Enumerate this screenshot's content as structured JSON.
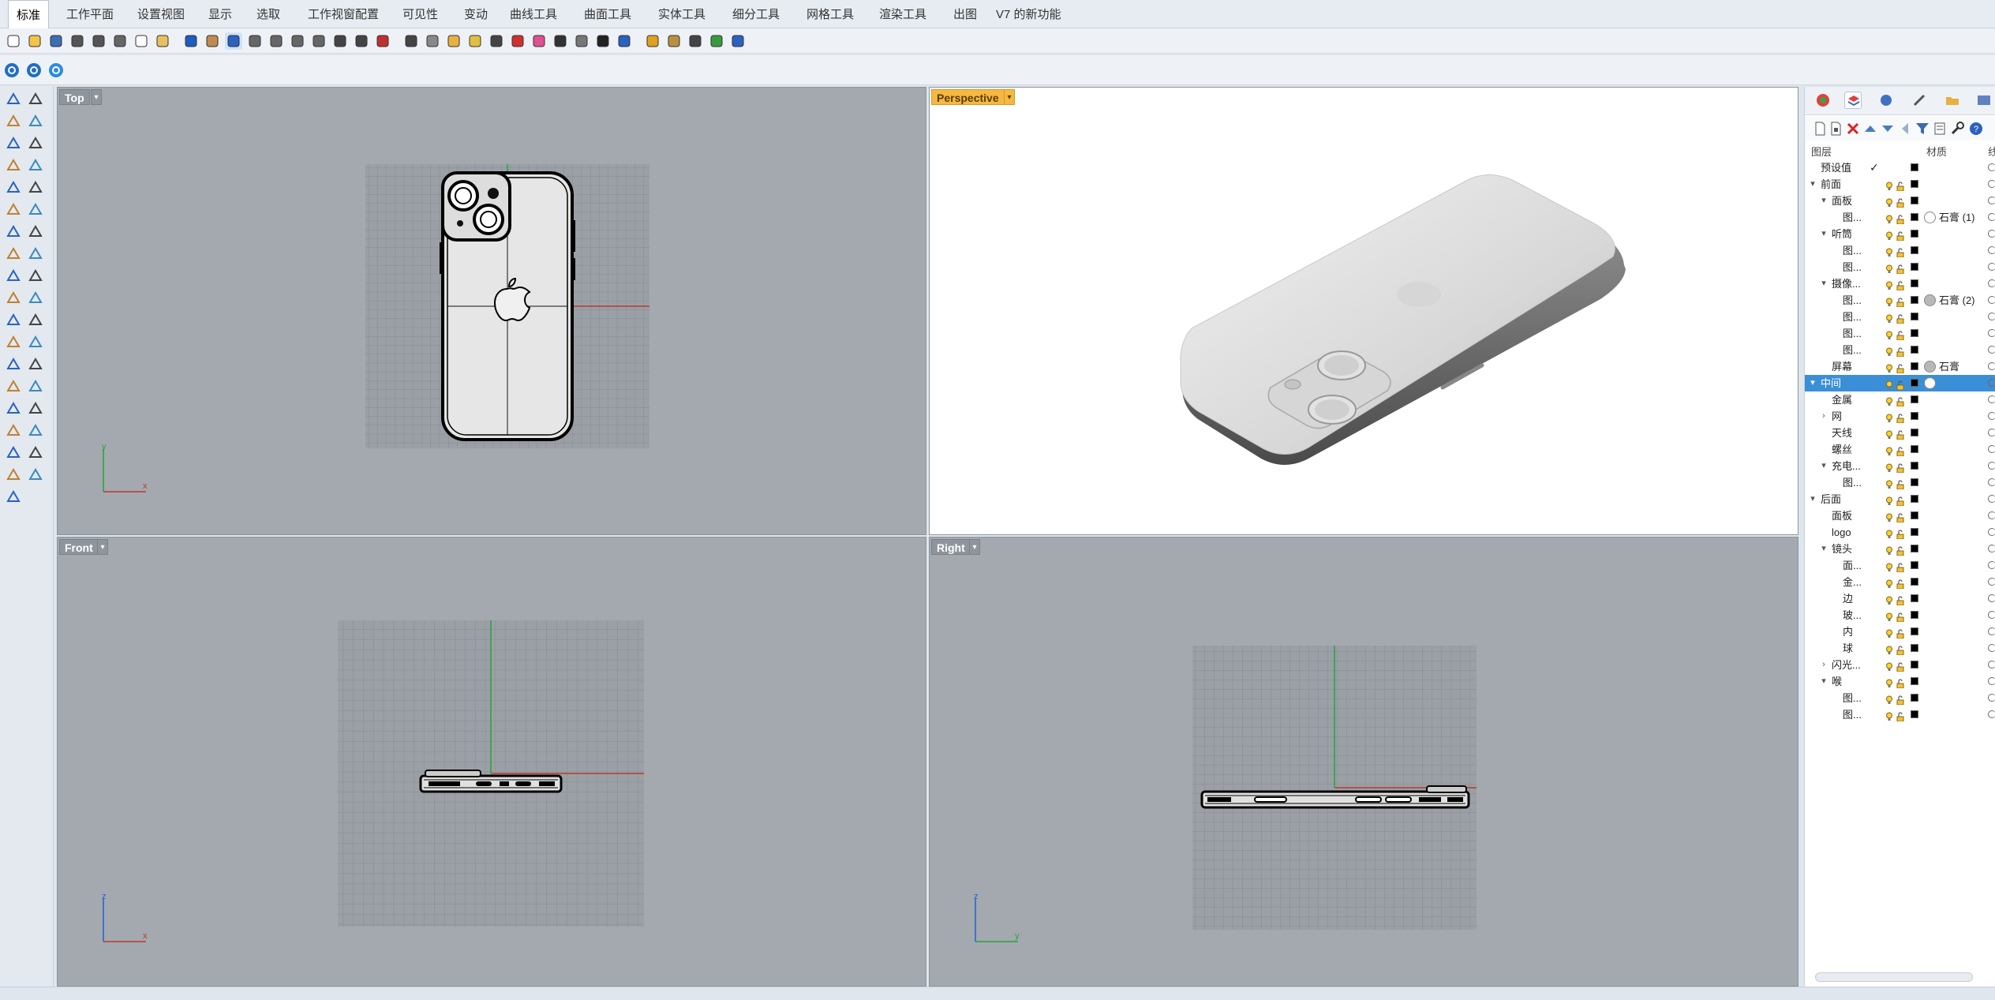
{
  "tabs": [
    {
      "label": "标准",
      "active": true
    },
    {
      "label": "工作平面"
    },
    {
      "label": "设置视图"
    },
    {
      "label": "显示"
    },
    {
      "label": "选取"
    },
    {
      "label": "工作视窗配置"
    },
    {
      "label": "可见性"
    },
    {
      "label": "变动"
    },
    {
      "label": "曲线工具"
    },
    {
      "label": "曲面工具"
    },
    {
      "label": "实体工具"
    },
    {
      "label": "细分工具"
    },
    {
      "label": "网格工具"
    },
    {
      "label": "渲染工具"
    },
    {
      "label": "出图"
    },
    {
      "label": "V7 的新功能"
    }
  ],
  "toolbar_icons": [
    "new-file-icon",
    "open-folder-icon",
    "save-icon",
    "print-icon",
    "import-icon",
    "cut-icon",
    "copy-icon",
    "paste-icon",
    "undo-icon",
    "pan-hand-icon",
    "select-point-icon",
    "zoom-icon",
    "zoom-window-icon",
    "zoom-extents-icon",
    "zoom-selected-icon",
    "rotate-view-icon",
    "viewport-layout-icon",
    "car-icon",
    "grid-snap-icon",
    "osnap-icon",
    "layer-icon",
    "light-icon",
    "lock-icon",
    "material-icon",
    "color-wheel-icon",
    "sphere-render-icon",
    "sphere-shaded-icon",
    "sphere-dark-icon",
    "globe-icon",
    "pen-icon",
    "gear-group-icon",
    "block-icon",
    "planet-icon",
    "help-icon"
  ],
  "viewports": {
    "top": {
      "title": "Top"
    },
    "perspective": {
      "title": "Perspective",
      "active": true
    },
    "front": {
      "title": "Front"
    },
    "right": {
      "title": "Right"
    }
  },
  "axes": {
    "top": {
      "x": "x",
      "y": "y"
    },
    "front": {
      "x": "x",
      "y": "z"
    },
    "right": {
      "x": "y",
      "y": "z"
    }
  },
  "layers_panel": {
    "header_layers": "图层",
    "header_material": "材质",
    "header_extra": "线",
    "rows": [
      {
        "name": "预设值",
        "indent": 0,
        "expander": "",
        "check": true,
        "selected": false,
        "material": ""
      },
      {
        "name": "前面",
        "indent": 0,
        "expander": "v",
        "selected": false,
        "material": ""
      },
      {
        "name": "面板",
        "indent": 1,
        "expander": "v",
        "selected": false,
        "material": ""
      },
      {
        "name": "图...",
        "indent": 2,
        "expander": "",
        "selected": false,
        "material": "石膏 (1)",
        "mat_circle": "white"
      },
      {
        "name": "听筒",
        "indent": 1,
        "expander": "v",
        "selected": false,
        "material": ""
      },
      {
        "name": "图...",
        "indent": 2,
        "expander": "",
        "selected": false,
        "material": ""
      },
      {
        "name": "图...",
        "indent": 2,
        "expander": "",
        "selected": false,
        "material": ""
      },
      {
        "name": "摄像...",
        "indent": 1,
        "expander": "v",
        "selected": false,
        "material": ""
      },
      {
        "name": "图...",
        "indent": 2,
        "expander": "",
        "selected": false,
        "material": "石膏 (2)",
        "mat_circle": "gray"
      },
      {
        "name": "图...",
        "indent": 2,
        "expander": "",
        "selected": false,
        "material": ""
      },
      {
        "name": "图...",
        "indent": 2,
        "expander": "",
        "selected": false,
        "material": ""
      },
      {
        "name": "图...",
        "indent": 2,
        "expander": "",
        "selected": false,
        "material": ""
      },
      {
        "name": "屏幕",
        "indent": 1,
        "expander": "",
        "selected": false,
        "material": "石膏",
        "mat_circle": "gray"
      },
      {
        "name": "中间",
        "indent": 0,
        "expander": "v",
        "selected": true,
        "material": "",
        "mat_circle": "white"
      },
      {
        "name": "金属",
        "indent": 1,
        "expander": "",
        "selected": false,
        "material": ""
      },
      {
        "name": "网",
        "indent": 1,
        "expander": ">",
        "selected": false,
        "material": ""
      },
      {
        "name": "天线",
        "indent": 1,
        "expander": "",
        "selected": false,
        "material": ""
      },
      {
        "name": "螺丝",
        "indent": 1,
        "expander": "",
        "selected": false,
        "material": ""
      },
      {
        "name": "充电...",
        "indent": 1,
        "expander": "v",
        "selected": false,
        "material": ""
      },
      {
        "name": "图...",
        "indent": 2,
        "expander": "",
        "selected": false,
        "material": ""
      },
      {
        "name": "后面",
        "indent": 0,
        "expander": "v",
        "selected": false,
        "material": ""
      },
      {
        "name": "面板",
        "indent": 1,
        "expander": "",
        "selected": false,
        "material": ""
      },
      {
        "name": "logo",
        "indent": 1,
        "expander": "",
        "selected": false,
        "material": ""
      },
      {
        "name": "镜头",
        "indent": 1,
        "expander": "v",
        "selected": false,
        "material": ""
      },
      {
        "name": "面...",
        "indent": 2,
        "expander": "",
        "selected": false,
        "material": ""
      },
      {
        "name": "金...",
        "indent": 2,
        "expander": "",
        "selected": false,
        "material": ""
      },
      {
        "name": "边",
        "indent": 2,
        "expander": "",
        "selected": false,
        "material": ""
      },
      {
        "name": "玻...",
        "indent": 2,
        "expander": "",
        "selected": false,
        "material": ""
      },
      {
        "name": "内",
        "indent": 2,
        "expander": "",
        "selected": false,
        "material": ""
      },
      {
        "name": "球",
        "indent": 2,
        "expander": "",
        "selected": false,
        "material": ""
      },
      {
        "name": "闪光...",
        "indent": 1,
        "expander": ">",
        "selected": false,
        "material": ""
      },
      {
        "name": "喉",
        "indent": 1,
        "expander": "v",
        "selected": false,
        "material": ""
      },
      {
        "name": "图...",
        "indent": 2,
        "expander": "",
        "selected": false,
        "material": ""
      },
      {
        "name": "图...",
        "indent": 2,
        "expander": "",
        "selected": false,
        "material": ""
      }
    ]
  },
  "colors": {
    "viewport_bg": "#a3a9af",
    "grid_bg": "#9aa0a6",
    "grid_line": "#868c92",
    "x_axis": "#c0392b",
    "y_axis": "#27a33b",
    "z_axis": "#2060d0",
    "active_title": "#f5b941",
    "selection": "#3b8fd6"
  }
}
